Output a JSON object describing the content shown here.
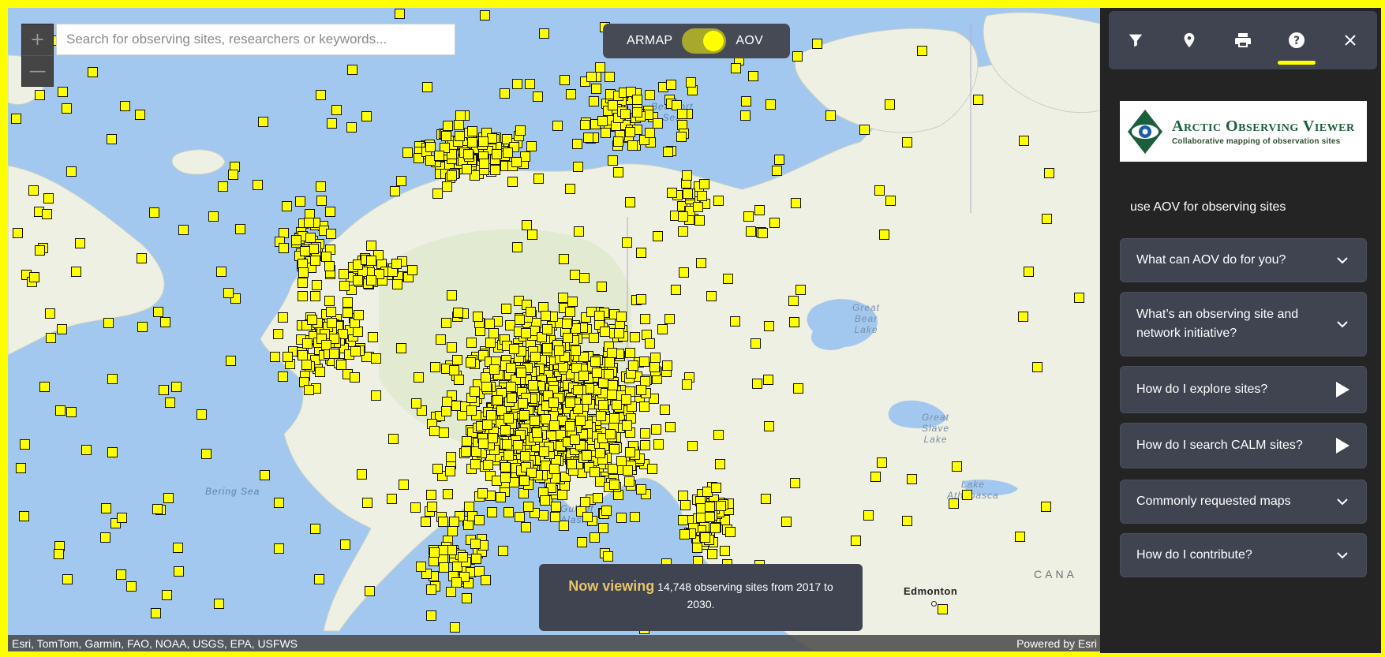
{
  "search": {
    "placeholder": "Search for observing sites, researchers or keywords..."
  },
  "zoom": {
    "in_label": "+",
    "out_label": "—"
  },
  "toggle": {
    "left_label": "ARMAP",
    "right_label": "AOV",
    "selected": "AOV"
  },
  "map_labels": {
    "beaufort_sea": "Beaufort\nSea",
    "bering_sea": "Bering Sea",
    "gulf_of_alaska": "Gulf of\nAlaska",
    "great_bear_lake": "Great\nBear\nLake",
    "great_slave_lake": "Great\nSlave\nLake",
    "lake_athabasca": "Lake\nAthabasca",
    "edmonton": "Edmonton",
    "canada": "CANA"
  },
  "now_viewing": {
    "label": "Now viewing",
    "text": "14,748 observing sites from 2017 to 2030."
  },
  "attribution": {
    "sources": "Esri, TomTom, Garmin, FAO, NOAA, USGS, EPA, USFWS",
    "powered_by": "Powered by Esri"
  },
  "panel": {
    "tools": [
      {
        "icon": "filter-icon"
      },
      {
        "icon": "location-pin-icon"
      },
      {
        "icon": "print-icon"
      },
      {
        "icon": "help-icon",
        "active": true
      },
      {
        "icon": "close-icon"
      }
    ],
    "logo": {
      "title": "Arctic Observing Viewer",
      "subtitle": "Collaborative mapping of observation sites"
    },
    "intro": "use AOV for observing sites",
    "faqs": [
      {
        "label": "What can AOV do for you?",
        "icon": "chevron-down-icon"
      },
      {
        "label": "What’s an observing site and network initiative?",
        "icon": "chevron-down-icon"
      },
      {
        "label": "How do I explore sites?",
        "icon": "play-icon"
      },
      {
        "label": "How do I search CALM sites?",
        "icon": "play-icon"
      },
      {
        "label": "Commonly requested maps",
        "icon": "chevron-down-icon"
      },
      {
        "label": "How do I contribute?",
        "icon": "chevron-down-icon"
      }
    ]
  },
  "colors": {
    "marker": "#ffff00",
    "water": "#a3c8f0",
    "land": "#eef0e4",
    "panel": "#242424",
    "accent": "#ffff00"
  }
}
